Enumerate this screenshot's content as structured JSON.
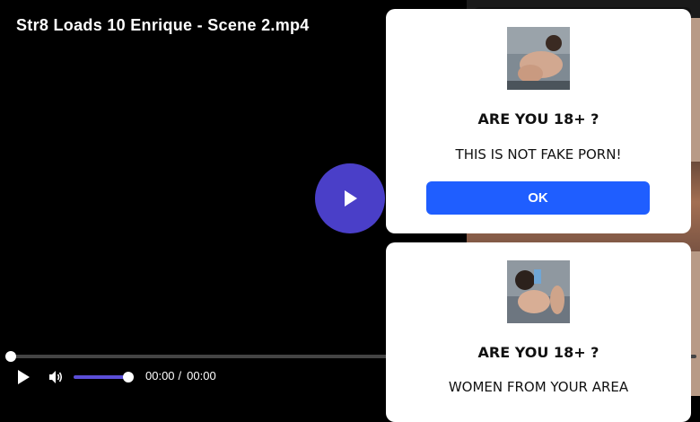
{
  "video": {
    "title": "Str8 Loads 10 Enrique - Scene 2.mp4",
    "current_time": "00:00",
    "separator": "/",
    "duration": "00:00",
    "progress": 0,
    "volume": 0.9
  },
  "popups": [
    {
      "heading": "ARE YOU 18+ ?",
      "text": "THIS IS NOT FAKE PORN!",
      "button_label": "OK"
    },
    {
      "heading": "ARE YOU 18+ ?",
      "text": "WOMEN FROM YOUR AREA"
    }
  ],
  "colors": {
    "accent": "#4a3fc8",
    "button": "#1f5eff",
    "volume": "#5b4ed8"
  }
}
